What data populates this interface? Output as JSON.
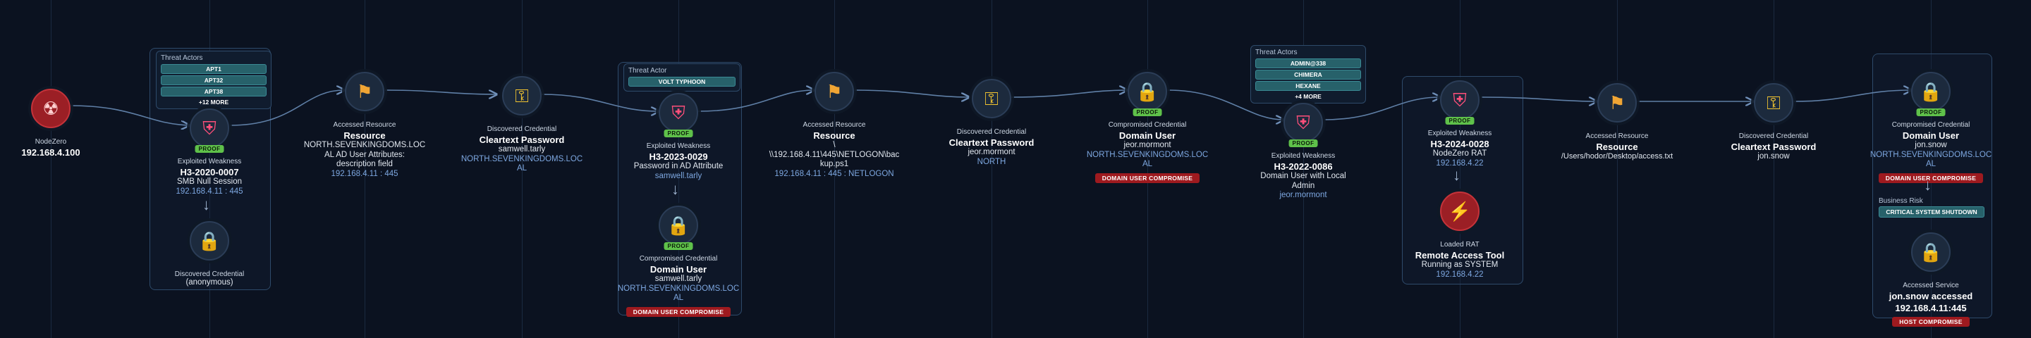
{
  "colors": {
    "background": "#0b1220",
    "link": "#5f7fa6",
    "proof_badge": "#5fc14a",
    "impact_badge": "#9e1a1f",
    "threat_pill": "#27616a",
    "weakness_red": "#9b1f25",
    "highlight_blue": "#7da7e0"
  },
  "nodes": {
    "start": {
      "icon": "nodezero-icon",
      "type": "NodeZero",
      "ip": "192.168.4.100"
    },
    "w1": {
      "icon": "weakness-shield-icon",
      "proof": "PROOF",
      "type": "Exploited Weakness",
      "id": "H3-2020-0007",
      "desc": "SMB Null Session",
      "host": "192.168.4.11 : 445"
    },
    "c1": {
      "icon": "lock-icon",
      "type": "Discovered Credential",
      "value": "(anonymous)"
    },
    "r1": {
      "icon": "flag-icon",
      "type": "Accessed Resource",
      "title": "Resource",
      "domain": "NORTH.SEVENKINGDOMS.LOC",
      "l1": "AL AD User Attributes:",
      "l2": "description field",
      "host": "192.168.4.11 : 445"
    },
    "k1": {
      "icon": "key-icon",
      "type": "Discovered Credential",
      "title": "Cleartext Password",
      "user": "samwell.tarly",
      "d1": "NORTH.SEVENKINGDOMS.LOC",
      "d2": "AL"
    },
    "w2": {
      "icon": "weakness-shield-icon",
      "proof": "PROOF",
      "type": "Exploited Weakness",
      "id": "H3-2023-0029",
      "desc": "Password in AD Attribute",
      "user": "samwell.tarly"
    },
    "c2": {
      "icon": "lock-icon",
      "proof": "PROOF",
      "type": "Compromised Credential",
      "title": "Domain User",
      "user": "samwell.tarly",
      "d1": "NORTH.SEVENKINGDOMS.LOC",
      "d2": "AL",
      "badge": "DOMAIN USER COMPROMISE"
    },
    "r2": {
      "icon": "flag-icon",
      "type": "Accessed Resource",
      "title": "Resource",
      "l0": "\\",
      "l1": "\\\\192.168.4.11\\445\\NETLOGON\\bac",
      "l2": "kup.ps1",
      "host": "192.168.4.11 : 445 : NETLOGON"
    },
    "k2": {
      "icon": "key-icon",
      "type": "Discovered Credential",
      "title": "Cleartext Password",
      "user": "jeor.mormont",
      "d1": "NORTH"
    },
    "c3": {
      "icon": "lock-icon",
      "proof": "PROOF",
      "type": "Compromised Credential",
      "title": "Domain User",
      "user": "jeor.mormont",
      "d1": "NORTH.SEVENKINGDOMS.LOC",
      "d2": "AL",
      "badge": "DOMAIN USER COMPROMISE"
    },
    "w3": {
      "icon": "weakness-shield-icon",
      "proof": "PROOF",
      "type": "Exploited Weakness",
      "id": "H3-2022-0086",
      "desc1": "Domain User with Local",
      "desc2": "Admin",
      "user": "jeor.mormont"
    },
    "w4": {
      "icon": "weakness-shield-icon",
      "proof": "PROOF",
      "type": "Exploited Weakness",
      "id": "H3-2024-0028",
      "desc": "NodeZero RAT",
      "host": "192.168.4.22"
    },
    "rat": {
      "icon": "lightning-icon",
      "type": "Loaded RAT",
      "title": "Remote Access Tool",
      "desc": "Running as SYSTEM",
      "host": "192.168.4.22"
    },
    "r3": {
      "icon": "flag-icon",
      "type": "Accessed Resource",
      "title": "Resource",
      "path": "/Users/hodor/Desktop/access.txt"
    },
    "k3": {
      "icon": "key-icon",
      "type": "Discovered Credential",
      "title": "Cleartext Password",
      "user": "jon.snow"
    },
    "c4": {
      "icon": "lock-icon",
      "proof": "PROOF",
      "type": "Compromised Credential",
      "title": "Domain User",
      "user": "jon.snow",
      "d1": "NORTH.SEVENKINGDOMS.LOC",
      "d2": "AL",
      "badge": "DOMAIN USER COMPROMISE"
    },
    "svc": {
      "icon": "lock-icon",
      "type": "Accessed Service",
      "title1": "jon.snow accessed",
      "title2": "192.168.4.11:445",
      "badge": "HOST COMPROMISE"
    }
  },
  "threats": {
    "g1": {
      "label": "Threat Actors",
      "items": [
        "APT1",
        "APT32",
        "APT38"
      ],
      "more": "+12 MORE"
    },
    "g2": {
      "label": "Threat Actor",
      "items": [
        "VOLT TYPHOON"
      ]
    },
    "g3": {
      "label": "Threat Actors",
      "items": [
        "ADMIN@338",
        "CHIMERA",
        "HEXANE"
      ],
      "more": "+4 MORE"
    }
  },
  "business_risk": {
    "label": "Business Risk",
    "value": "CRITICAL SYSTEM SHUTDOWN"
  }
}
